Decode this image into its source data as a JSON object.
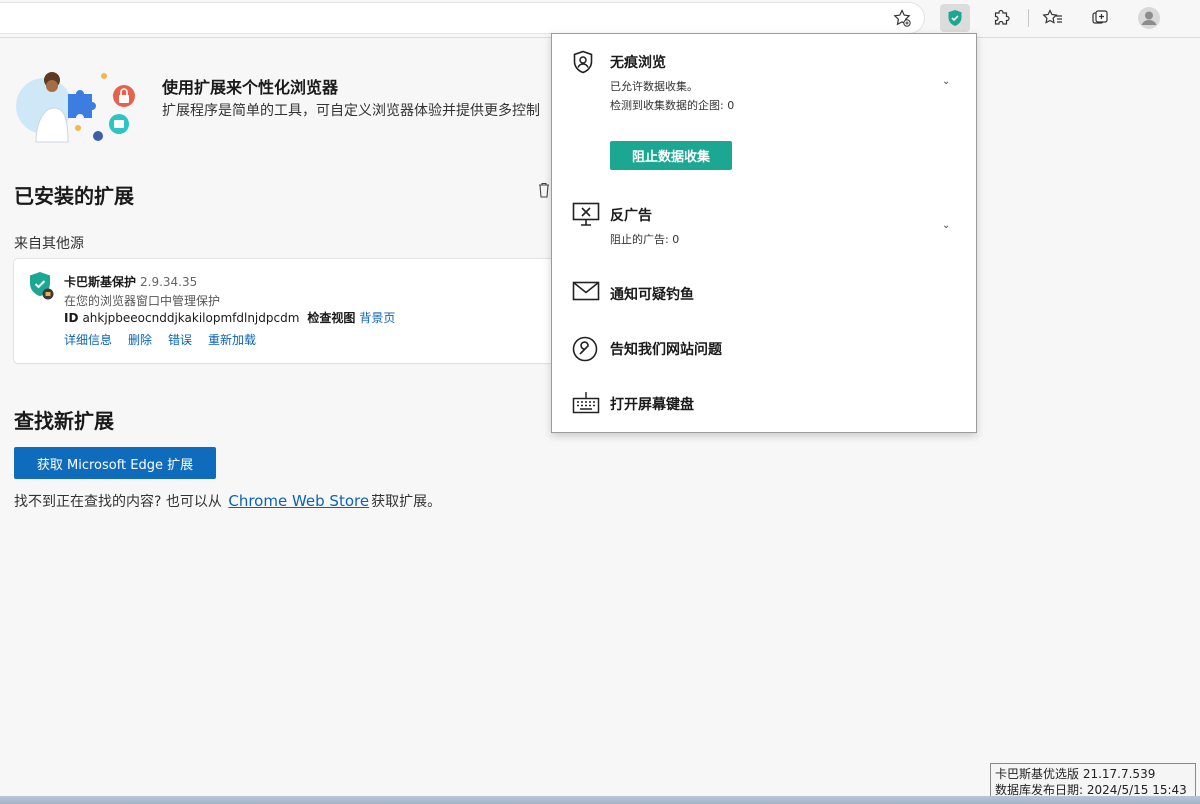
{
  "hero": {
    "title": "使用扩展来个性化浏览器",
    "description": "扩展程序是简单的工具，可自定义浏览器体验并提供更多控制"
  },
  "installed": {
    "heading": "已安装的扩展",
    "source_label": "来自其他源",
    "extension": {
      "name": "卡巴斯基保护",
      "version": "2.9.34.35",
      "description": "在您的浏览器窗口中管理保护",
      "id_label": "ID",
      "id_value": "ahkjpbeeocnddjkakilopmfdlnjdpcdm",
      "inspect_label": "检查视图",
      "background_link": "背景页",
      "actions": [
        "详细信息",
        "删除",
        "错误",
        "重新加载"
      ]
    }
  },
  "find": {
    "heading": "查找新扩展",
    "button": "获取 Microsoft Edge 扩展",
    "line_prefix": "找不到正在查找的内容? 也可以从",
    "line_link": "Chrome Web Store",
    "line_suffix": "获取扩展。"
  },
  "popup": {
    "private_browsing": {
      "title": "无痕浏览",
      "status": "已允许数据收集。",
      "detected": "检测到收集数据的企图: 0",
      "button": "阻止数据收集"
    },
    "anti_banner": {
      "title": "反广告",
      "blocked": "阻止的广告: 0"
    },
    "items": [
      "通知可疑钓鱼",
      "告知我们网站问题",
      "打开屏幕键盘"
    ]
  },
  "status": {
    "line1": "卡巴斯基优选版 21.17.7.539",
    "line2": "数据库发布日期: 2024/5/15 15:43"
  },
  "colors": {
    "accent_blue": "#0f6cbd",
    "kaspersky_green": "#1ba792",
    "link_blue": "#0b63b6"
  }
}
